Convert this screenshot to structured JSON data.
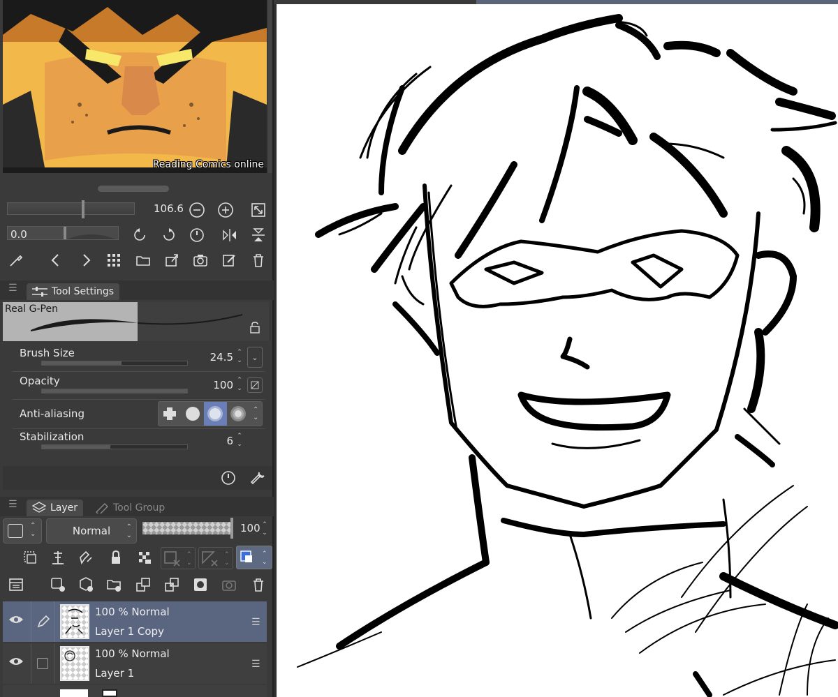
{
  "navigator": {
    "watermark": "Reading Comics online",
    "zoom_value": "106.6",
    "rotation_value": "0.0"
  },
  "tool_settings": {
    "tab_label": "Tool Settings",
    "brush_name": "Real G-Pen",
    "properties": [
      {
        "label": "Brush Size",
        "value": "24.5",
        "fill": 0.55
      },
      {
        "label": "Opacity",
        "value": "100",
        "fill": 1.0
      },
      {
        "label": "Anti-aliasing",
        "value": ""
      },
      {
        "label": "Stabilization",
        "value": "6",
        "fill": 0.47
      }
    ],
    "anti_aliasing_selected": 2
  },
  "layer_panel": {
    "tab_label": "Layer",
    "tab2_label": "Tool Group",
    "blend_mode": "Normal",
    "opacity": "100",
    "layers": [
      {
        "mode": "100 %  Normal",
        "name": "Layer 1 Copy",
        "selected": true
      },
      {
        "mode": "100 %  Normal",
        "name": "Layer 1",
        "selected": false
      }
    ]
  },
  "colors": {
    "panel_bg": "#3a3a3a",
    "selected_layer": "#5a6580",
    "accent": "#6a7fb8"
  }
}
